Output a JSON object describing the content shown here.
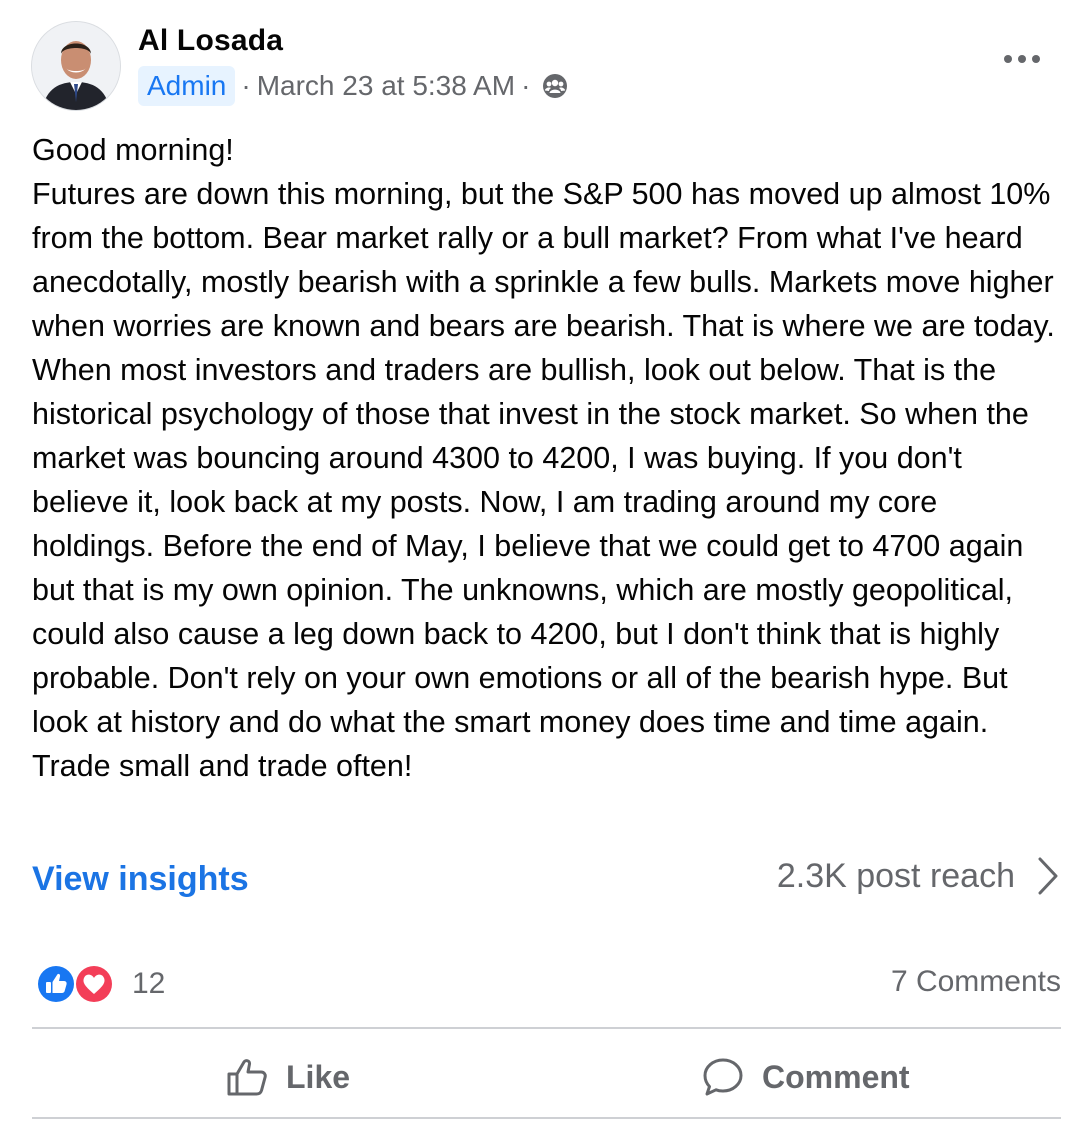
{
  "post": {
    "author": "Al Losada",
    "badge": "Admin",
    "separator_1": "·",
    "timestamp": "March 23 at 5:38 AM",
    "separator_2": "·",
    "audience_icon": "group-audience-icon",
    "more_icon": "more-options-icon",
    "text_lines": [
      "Good morning!",
      "Futures are down this morning, but the S&P 500 has moved up almost 10% from the bottom. Bear market rally or a bull market? From what I've heard anecdotally, mostly bearish with a sprinkle a few bulls. Markets move higher when worries are known and bears are bearish. That is where we are today. When most investors and traders are bullish, look out below. That is the historical psychology of those that invest in the stock market. So when the market was bouncing around 4300 to 4200, I was buying. If you don't believe it, look back at my posts. Now, I am trading around my core holdings. Before the end of May, I believe that we could get to 4700 again but that is my own opinion. The unknowns, which are mostly geopolitical, could also cause a leg down back to 4200, but I don't think that is highly probable. Don't rely on your own emotions or all of the bearish hype. But look at history and do what the smart money does time and time again. Trade small and trade often!"
    ]
  },
  "insights": {
    "label": "View insights",
    "reach": "2.3K post reach",
    "chevron_icon": "chevron-right-icon"
  },
  "engagement": {
    "reaction_icons": [
      "like-reaction-icon",
      "love-reaction-icon"
    ],
    "reaction_count": "12",
    "comments": "7 Comments"
  },
  "actions": {
    "like": "Like",
    "like_icon": "thumbs-up-icon",
    "comment": "Comment",
    "comment_icon": "comment-bubble-icon"
  },
  "colors": {
    "link_blue": "#1b74e4",
    "secondary_text": "#65676b",
    "admin_badge_bg": "#e7f3ff",
    "like_blue": "#1877f2",
    "love_red": "#f33e58",
    "divider": "#ced0d4"
  }
}
